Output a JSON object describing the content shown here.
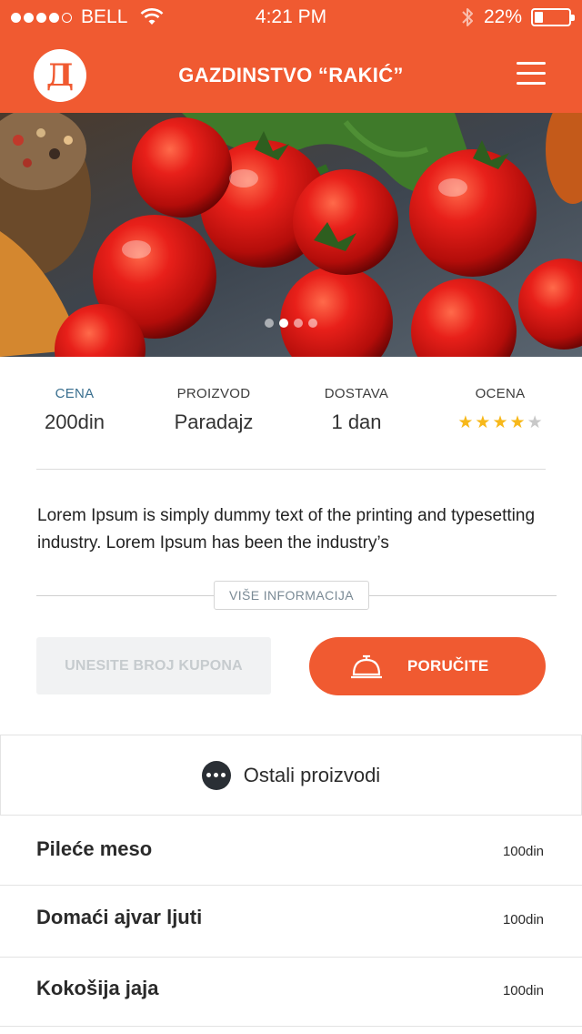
{
  "status_bar": {
    "carrier": "BELL",
    "time": "4:21 PM",
    "battery": "22%",
    "battery_level": 0.22,
    "signal_bars_filled": 4,
    "signal_bars_total": 5
  },
  "header": {
    "logo_letter": "Д",
    "title": "GAZDINSTVO “RAKIĆ”"
  },
  "hero": {
    "pages_total": 4,
    "active_page": 2
  },
  "info": {
    "price": {
      "label": "CENA",
      "value": "200din"
    },
    "product": {
      "label": "PROIZVOD",
      "value": "Paradajz"
    },
    "delivery": {
      "label": "DOSTAVA",
      "value": "1 dan"
    },
    "rating": {
      "label": "OCENA",
      "stars": 4,
      "max": 5
    }
  },
  "description": "Lorem Ipsum is simply dummy text of the printing and typesetting industry. Lorem Ipsum has been the industry’s",
  "more_info_label": "VIŠE INFORMACIJA",
  "coupon_placeholder": "UNESITE BROJ KUPONA",
  "order_label": "PORUČITE",
  "others_label": "Ostali proizvodi",
  "products": [
    {
      "name": "Pileće meso",
      "price": "100din"
    },
    {
      "name": "Domaći ajvar ljuti",
      "price": "100din"
    },
    {
      "name": "Kokošija jaja",
      "price": "100din"
    }
  ],
  "colors": {
    "accent": "#f05a31",
    "star": "#f7b81a",
    "label_blue": "#3a6f8f"
  }
}
